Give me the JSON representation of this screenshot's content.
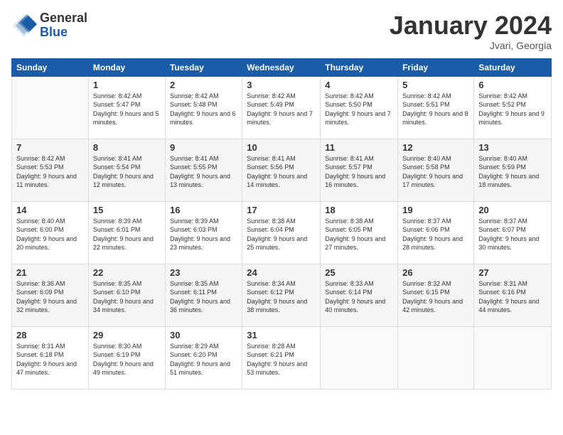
{
  "logo": {
    "general": "General",
    "blue": "Blue"
  },
  "header": {
    "month": "January 2024",
    "location": "Jvari, Georgia"
  },
  "weekdays": [
    "Sunday",
    "Monday",
    "Tuesday",
    "Wednesday",
    "Thursday",
    "Friday",
    "Saturday"
  ],
  "weeks": [
    [
      {
        "day": "",
        "sunrise": "",
        "sunset": "",
        "daylight": ""
      },
      {
        "day": "1",
        "sunrise": "Sunrise: 8:42 AM",
        "sunset": "Sunset: 5:47 PM",
        "daylight": "Daylight: 9 hours and 5 minutes."
      },
      {
        "day": "2",
        "sunrise": "Sunrise: 8:42 AM",
        "sunset": "Sunset: 5:48 PM",
        "daylight": "Daylight: 9 hours and 6 minutes."
      },
      {
        "day": "3",
        "sunrise": "Sunrise: 8:42 AM",
        "sunset": "Sunset: 5:49 PM",
        "daylight": "Daylight: 9 hours and 7 minutes."
      },
      {
        "day": "4",
        "sunrise": "Sunrise: 8:42 AM",
        "sunset": "Sunset: 5:50 PM",
        "daylight": "Daylight: 9 hours and 7 minutes."
      },
      {
        "day": "5",
        "sunrise": "Sunrise: 8:42 AM",
        "sunset": "Sunset: 5:51 PM",
        "daylight": "Daylight: 9 hours and 8 minutes."
      },
      {
        "day": "6",
        "sunrise": "Sunrise: 8:42 AM",
        "sunset": "Sunset: 5:52 PM",
        "daylight": "Daylight: 9 hours and 9 minutes."
      }
    ],
    [
      {
        "day": "7",
        "sunrise": "Sunrise: 8:42 AM",
        "sunset": "Sunset: 5:53 PM",
        "daylight": "Daylight: 9 hours and 11 minutes."
      },
      {
        "day": "8",
        "sunrise": "Sunrise: 8:41 AM",
        "sunset": "Sunset: 5:54 PM",
        "daylight": "Daylight: 9 hours and 12 minutes."
      },
      {
        "day": "9",
        "sunrise": "Sunrise: 8:41 AM",
        "sunset": "Sunset: 5:55 PM",
        "daylight": "Daylight: 9 hours and 13 minutes."
      },
      {
        "day": "10",
        "sunrise": "Sunrise: 8:41 AM",
        "sunset": "Sunset: 5:56 PM",
        "daylight": "Daylight: 9 hours and 14 minutes."
      },
      {
        "day": "11",
        "sunrise": "Sunrise: 8:41 AM",
        "sunset": "Sunset: 5:57 PM",
        "daylight": "Daylight: 9 hours and 16 minutes."
      },
      {
        "day": "12",
        "sunrise": "Sunrise: 8:40 AM",
        "sunset": "Sunset: 5:58 PM",
        "daylight": "Daylight: 9 hours and 17 minutes."
      },
      {
        "day": "13",
        "sunrise": "Sunrise: 8:40 AM",
        "sunset": "Sunset: 5:59 PM",
        "daylight": "Daylight: 9 hours and 18 minutes."
      }
    ],
    [
      {
        "day": "14",
        "sunrise": "Sunrise: 8:40 AM",
        "sunset": "Sunset: 6:00 PM",
        "daylight": "Daylight: 9 hours and 20 minutes."
      },
      {
        "day": "15",
        "sunrise": "Sunrise: 8:39 AM",
        "sunset": "Sunset: 6:01 PM",
        "daylight": "Daylight: 9 hours and 22 minutes."
      },
      {
        "day": "16",
        "sunrise": "Sunrise: 8:39 AM",
        "sunset": "Sunset: 6:03 PM",
        "daylight": "Daylight: 9 hours and 23 minutes."
      },
      {
        "day": "17",
        "sunrise": "Sunrise: 8:38 AM",
        "sunset": "Sunset: 6:04 PM",
        "daylight": "Daylight: 9 hours and 25 minutes."
      },
      {
        "day": "18",
        "sunrise": "Sunrise: 8:38 AM",
        "sunset": "Sunset: 6:05 PM",
        "daylight": "Daylight: 9 hours and 27 minutes."
      },
      {
        "day": "19",
        "sunrise": "Sunrise: 8:37 AM",
        "sunset": "Sunset: 6:06 PM",
        "daylight": "Daylight: 9 hours and 28 minutes."
      },
      {
        "day": "20",
        "sunrise": "Sunrise: 8:37 AM",
        "sunset": "Sunset: 6:07 PM",
        "daylight": "Daylight: 9 hours and 30 minutes."
      }
    ],
    [
      {
        "day": "21",
        "sunrise": "Sunrise: 8:36 AM",
        "sunset": "Sunset: 6:09 PM",
        "daylight": "Daylight: 9 hours and 32 minutes."
      },
      {
        "day": "22",
        "sunrise": "Sunrise: 8:35 AM",
        "sunset": "Sunset: 6:10 PM",
        "daylight": "Daylight: 9 hours and 34 minutes."
      },
      {
        "day": "23",
        "sunrise": "Sunrise: 8:35 AM",
        "sunset": "Sunset: 6:11 PM",
        "daylight": "Daylight: 9 hours and 36 minutes."
      },
      {
        "day": "24",
        "sunrise": "Sunrise: 8:34 AM",
        "sunset": "Sunset: 6:12 PM",
        "daylight": "Daylight: 9 hours and 38 minutes."
      },
      {
        "day": "25",
        "sunrise": "Sunrise: 8:33 AM",
        "sunset": "Sunset: 6:14 PM",
        "daylight": "Daylight: 9 hours and 40 minutes."
      },
      {
        "day": "26",
        "sunrise": "Sunrise: 8:32 AM",
        "sunset": "Sunset: 6:15 PM",
        "daylight": "Daylight: 9 hours and 42 minutes."
      },
      {
        "day": "27",
        "sunrise": "Sunrise: 8:31 AM",
        "sunset": "Sunset: 6:16 PM",
        "daylight": "Daylight: 9 hours and 44 minutes."
      }
    ],
    [
      {
        "day": "28",
        "sunrise": "Sunrise: 8:31 AM",
        "sunset": "Sunset: 6:18 PM",
        "daylight": "Daylight: 9 hours and 47 minutes."
      },
      {
        "day": "29",
        "sunrise": "Sunrise: 8:30 AM",
        "sunset": "Sunset: 6:19 PM",
        "daylight": "Daylight: 9 hours and 49 minutes."
      },
      {
        "day": "30",
        "sunrise": "Sunrise: 8:29 AM",
        "sunset": "Sunset: 6:20 PM",
        "daylight": "Daylight: 9 hours and 51 minutes."
      },
      {
        "day": "31",
        "sunrise": "Sunrise: 8:28 AM",
        "sunset": "Sunset: 6:21 PM",
        "daylight": "Daylight: 9 hours and 53 minutes."
      },
      {
        "day": "",
        "sunrise": "",
        "sunset": "",
        "daylight": ""
      },
      {
        "day": "",
        "sunrise": "",
        "sunset": "",
        "daylight": ""
      },
      {
        "day": "",
        "sunrise": "",
        "sunset": "",
        "daylight": ""
      }
    ]
  ]
}
